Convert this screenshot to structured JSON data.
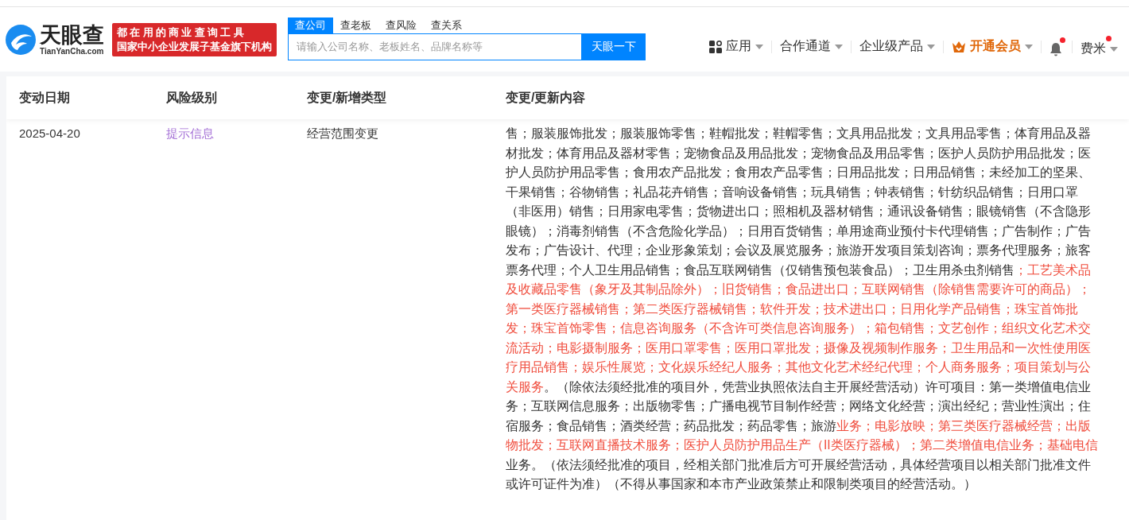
{
  "header": {
    "logo": {
      "name": "天眼查",
      "domain": "TianYanCha.com"
    },
    "slogan": {
      "line_1": "都在用的商业查询工具",
      "line_2": "国家中小企业发展子基金旗下机构"
    },
    "search": {
      "tabs": [
        {
          "label": "查公司",
          "selected": true
        },
        {
          "label": "查老板",
          "selected": false
        },
        {
          "label": "查风险",
          "selected": false
        },
        {
          "label": "查关系",
          "selected": false
        }
      ],
      "placeholder": "请输入公司名称、老板姓名、品牌名称等",
      "button": "天眼一下"
    },
    "nav": [
      {
        "kind": "apps",
        "label": "应用"
      },
      {
        "kind": "plain",
        "label": "合作通道"
      },
      {
        "kind": "plain",
        "label": "企业级产品"
      },
      {
        "kind": "vip",
        "label": "开通会员"
      },
      {
        "kind": "bell",
        "dot": true
      },
      {
        "kind": "user",
        "label": "费米",
        "dot": true
      }
    ]
  },
  "table": {
    "columns": [
      "变动日期",
      "风险级别",
      "变更/新增类型",
      "变更/更新内容"
    ],
    "rows": [
      {
        "date": "2025-04-20",
        "risk": "提示信息",
        "type": "经营范围变更",
        "content_lines": [
          [
            {
              "highlight": false,
              "text": "售；服装服饰批发；服装服饰零售；鞋帽批发；鞋帽零售；文具用品批发；文具用品零售；体育用品及器"
            }
          ],
          [
            {
              "highlight": false,
              "text": "材批发；体育用品及器材零售；宠物食品及用品批发；宠物食品及用品零售；医护人员防护用品批发；医"
            }
          ],
          [
            {
              "highlight": false,
              "text": "护人员防护用品零售；食用农产品批发；食用农产品零售；日用品批发；日用品销售；未经加工的坚果、"
            }
          ],
          [
            {
              "highlight": false,
              "text": "干果销售；谷物销售；礼品花卉销售；音响设备销售；玩具销售；钟表销售；针纺织品销售；日用口罩"
            }
          ],
          [
            {
              "highlight": false,
              "text": "（非医用）销售；日用家电零售；货物进出口；照相机及器材销售；通讯设备销售；眼镜销售（不含隐形"
            }
          ],
          [
            {
              "highlight": false,
              "text": "眼镜）；消毒剂销售（不含危险化学品）；日用百货销售；单用途商业预付卡代理销售；广告制作；广告"
            }
          ],
          [
            {
              "highlight": false,
              "text": "发布；广告设计、代理；企业形象策划；会议及展览服务；旅游开发项目策划咨询；票务代理服务；旅客"
            }
          ],
          [
            {
              "highlight": false,
              "text": "票务代理；个人卫生用品销售；食品互联网销售（仅销售预包装食品）；卫生用杀虫剂销售"
            },
            {
              "highlight": true,
              "text": "；工艺美术品"
            }
          ],
          [
            {
              "highlight": true,
              "text": "及收藏品零售（象牙及其制品除外）；旧货销售；食品进出口；互联网销售（除销售需要许可的商品）；"
            }
          ],
          [
            {
              "highlight": true,
              "text": "第一类医疗器械销售；第二类医疗器械销售；软件开发；技术进出口；日用化学产品销售；珠宝首饰批"
            }
          ],
          [
            {
              "highlight": true,
              "text": "发；珠宝首饰零售；信息咨询服务（不含许可类信息咨询服务）；箱包销售；文艺创作；组织文化艺术交"
            }
          ],
          [
            {
              "highlight": true,
              "text": "流活动；电影摄制服务；医用口罩零售；医用口罩批发；摄像及视频制作服务；卫生用品和一次性使用医"
            }
          ],
          [
            {
              "highlight": true,
              "text": "疗用品销售；娱乐性展览；文化娱乐经纪人服务；其他文化艺术经纪代理；个人商务服务；项目策划与公"
            }
          ],
          [
            {
              "highlight": true,
              "text": "关服务"
            },
            {
              "highlight": false,
              "text": "。（除依法须经批准的项目外，凭营业执照依法自主开展经营活动）许可项目：第一类增值电信业"
            }
          ],
          [
            {
              "highlight": false,
              "text": "务；互联网信息服务；出版物零售；广播电视节目制作经营；网络文化经营；演出经纪；营业性演出；住"
            }
          ],
          [
            {
              "highlight": false,
              "text": "宿服务；食品销售；酒类经营；药品批发；药品零售；旅游"
            },
            {
              "highlight": true,
              "text": "业务；电影放映；第三类医疗器械经营；出版"
            }
          ],
          [
            {
              "highlight": true,
              "text": "物批发；互联网直播技术服务；医护人员防护用品生产（II类医疗器械）；第二类增值电信业务；基础电信"
            }
          ],
          [
            {
              "highlight": false,
              "text": "业务。（依法须经批准的项目，经相关部门批准后方可开展经营活动，具体经营项目以相关部门批准文件"
            }
          ],
          [
            {
              "highlight": false,
              "text": "或许可证件为准）（不得从事国家和本市产业政策禁止和限制类项目的经营活动。）"
            }
          ]
        ]
      }
    ]
  }
}
